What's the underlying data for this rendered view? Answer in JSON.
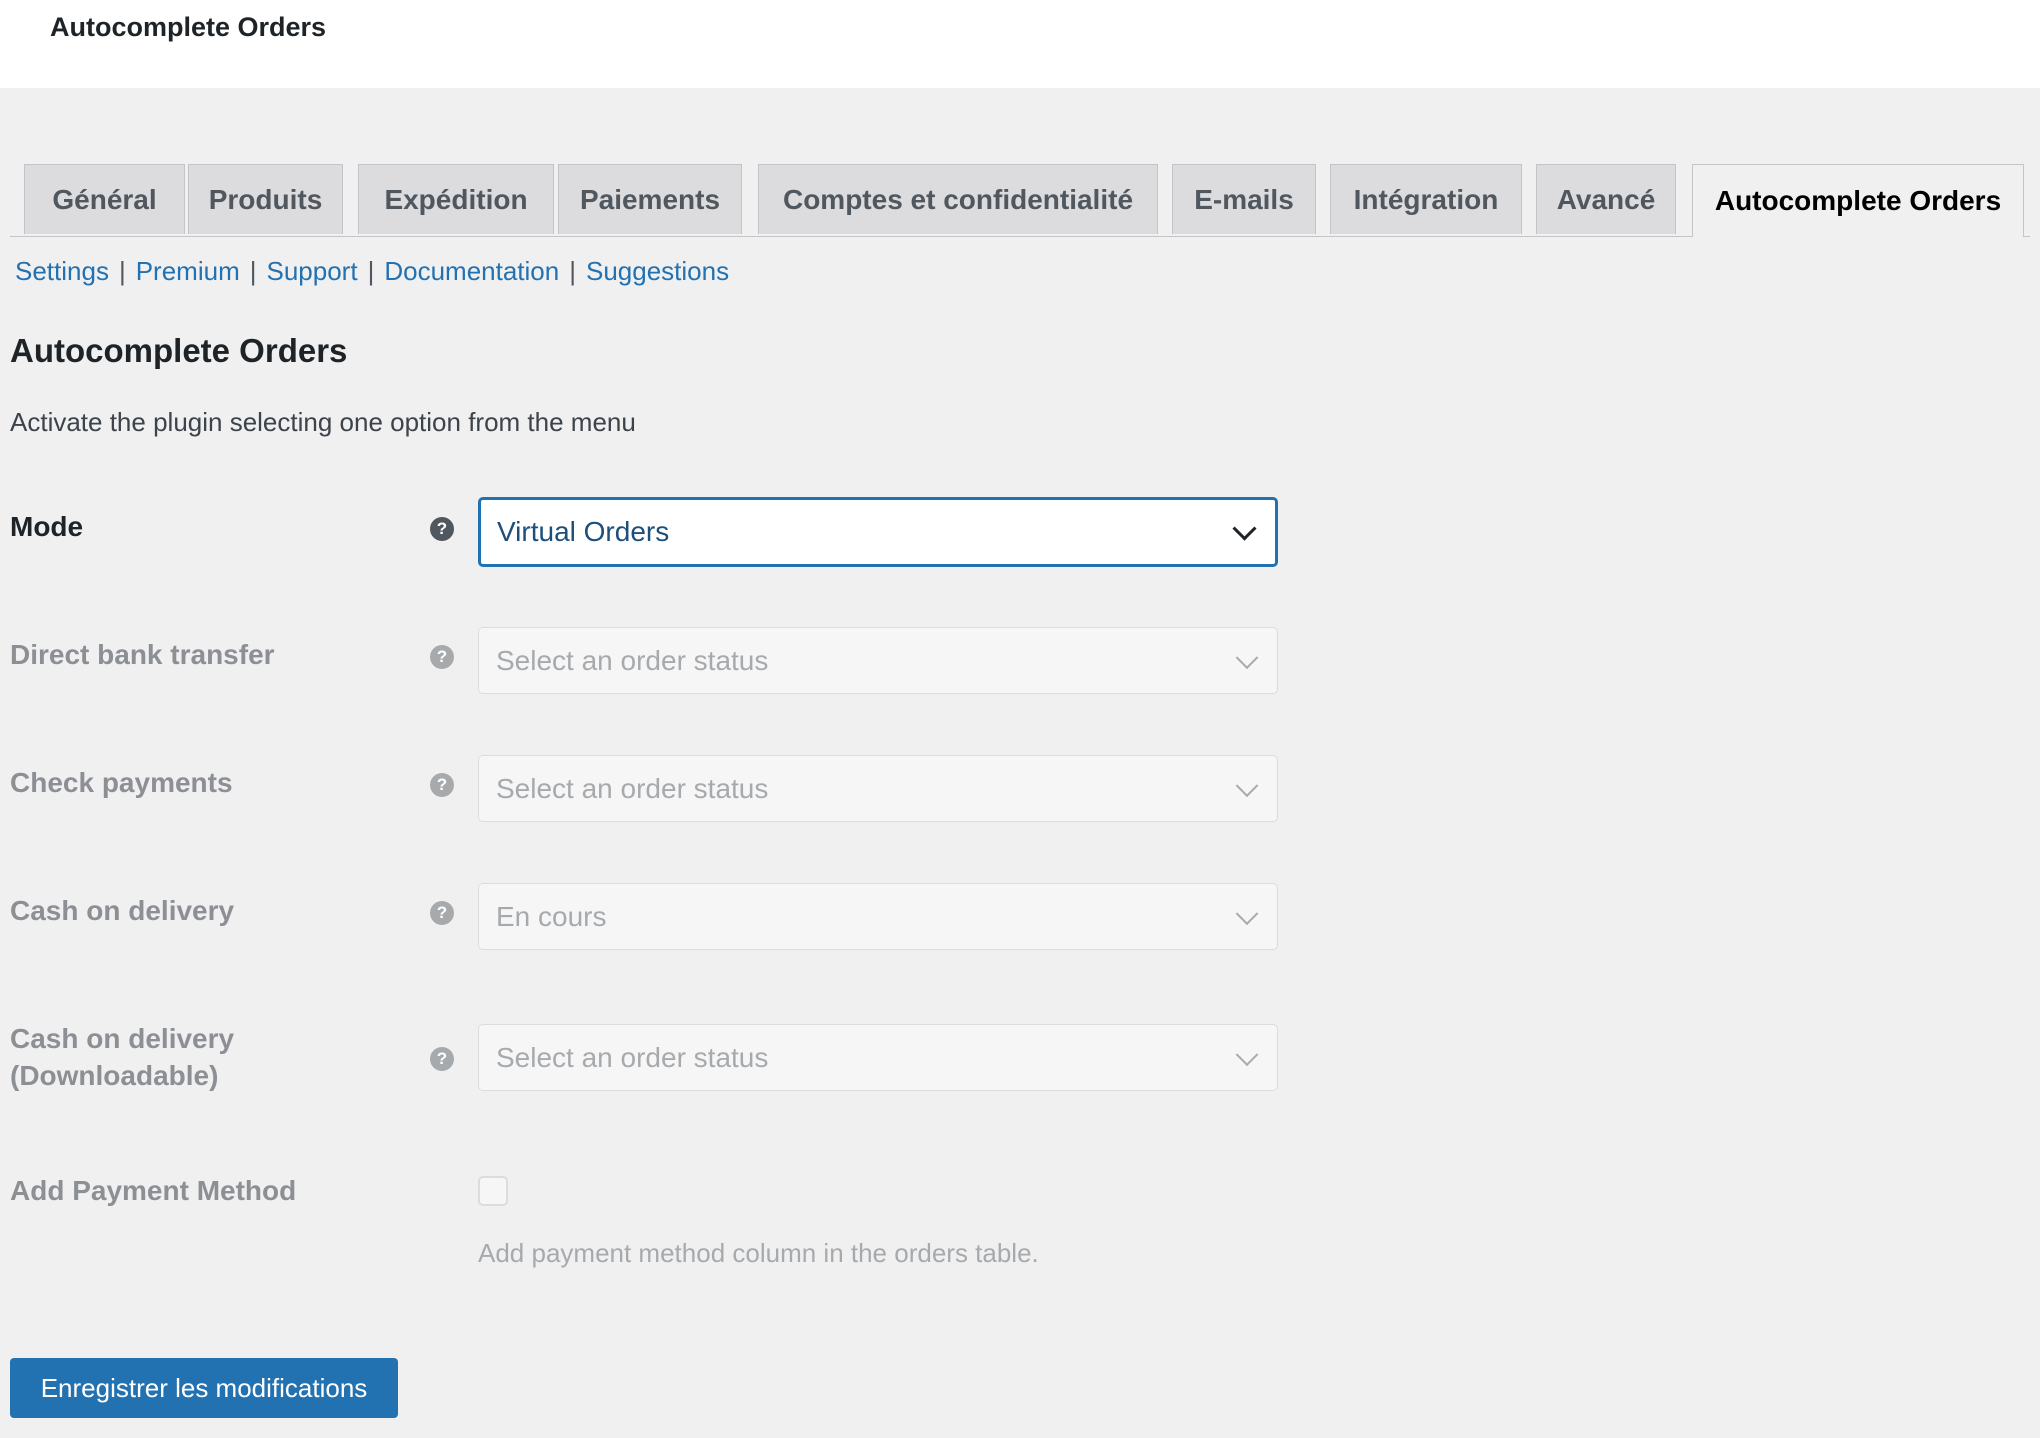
{
  "header": {
    "title": "Autocomplete Orders"
  },
  "tabs": [
    {
      "label": "Général"
    },
    {
      "label": "Produits"
    },
    {
      "label": "Expédition"
    },
    {
      "label": "Paiements"
    },
    {
      "label": "Comptes et confidentialité"
    },
    {
      "label": "E-mails"
    },
    {
      "label": "Intégration"
    },
    {
      "label": "Avancé"
    },
    {
      "label": "Autocomplete Orders",
      "active": true
    }
  ],
  "subnav": [
    {
      "label": "Settings"
    },
    {
      "label": "Premium"
    },
    {
      "label": "Support"
    },
    {
      "label": "Documentation"
    },
    {
      "label": "Suggestions"
    }
  ],
  "subnav_separator": "|",
  "page": {
    "title": "Autocomplete Orders",
    "description": "Activate the plugin selecting one option from the menu"
  },
  "help_glyph": "?",
  "fields": [
    {
      "label": "Mode",
      "value": "Virtual Orders",
      "enabled": true
    },
    {
      "label": "Direct bank transfer",
      "value": "Select an order status",
      "enabled": false
    },
    {
      "label": "Check payments",
      "value": "Select an order status",
      "enabled": false
    },
    {
      "label": "Cash on delivery",
      "value": "En cours",
      "enabled": false
    },
    {
      "label_line1": "Cash on delivery",
      "label_line2": "(Downloadable)",
      "value": "Select an order status",
      "enabled": false
    }
  ],
  "payment_method": {
    "label": "Add Payment Method",
    "checked": false,
    "description": "Add payment method column in the orders table."
  },
  "save_button": {
    "label": "Enregistrer les modifications"
  },
  "colors": {
    "accent": "#2271b1",
    "background": "#f0f0f1",
    "disabled_text": "#a7aaad"
  }
}
